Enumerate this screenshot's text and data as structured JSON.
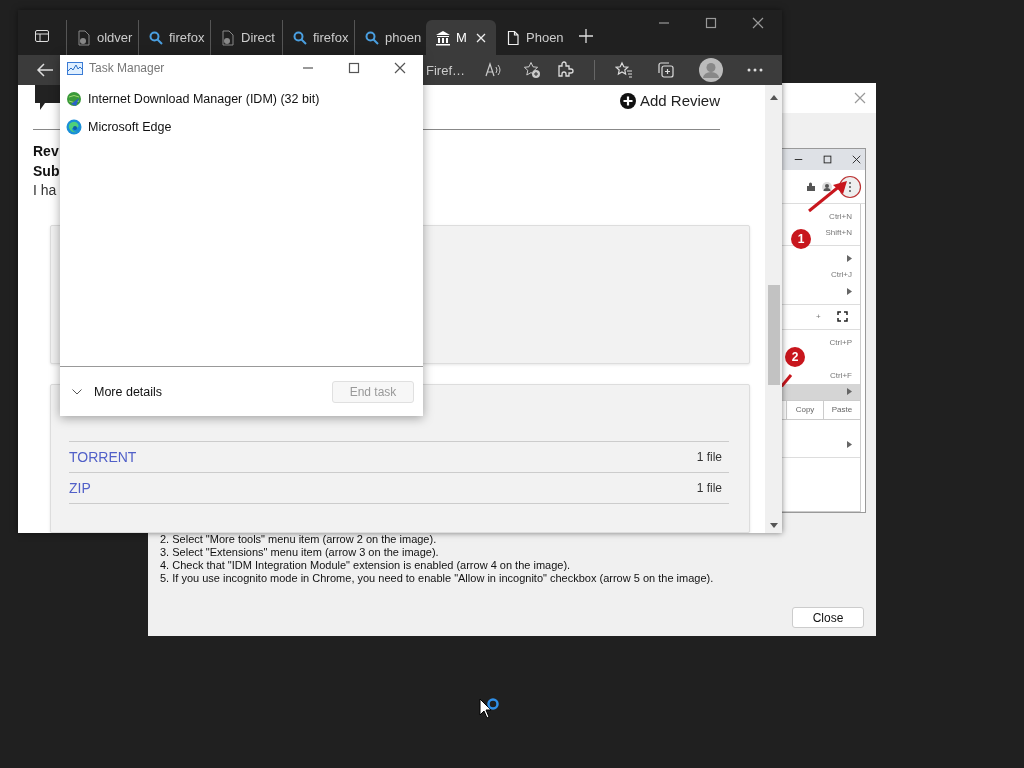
{
  "idm_dialog": {
    "screenshot": {
      "shortcuts": [
        {
          "kind": "text",
          "text": "Ctrl+N"
        },
        {
          "kind": "text",
          "text": "Shift+N"
        },
        {
          "kind": "sep"
        },
        {
          "kind": "sub"
        },
        {
          "kind": "text",
          "text": "Ctrl+J"
        },
        {
          "kind": "sub"
        },
        {
          "kind": "sep"
        },
        {
          "kind": "zoom",
          "text": "+"
        },
        {
          "kind": "sep"
        },
        {
          "kind": "text",
          "text": "Ctrl+P"
        },
        {
          "kind": "blank"
        },
        {
          "kind": "text",
          "text": "Ctrl+F"
        },
        {
          "kind": "hilite"
        },
        {
          "kind": "edit",
          "texts": [
            "Copy",
            "Paste"
          ]
        },
        {
          "kind": "blank"
        },
        {
          "kind": "sub"
        },
        {
          "kind": "sep"
        }
      ],
      "callouts": [
        "1",
        "2"
      ]
    },
    "instructions": [
      "2. Select \"More tools\" menu item (arrow 2 on the image).",
      "3. Select \"Extensions\" menu item (arrow 3 on the image).",
      "4. Check that \"IDM Integration Module\" extension is enabled (arrow 4 on the image).",
      "5. If you use incognito mode in Chrome, you need to enable \"Allow in incognito\" checkbox (arrow 5 on the image)."
    ],
    "close_button": "Close"
  },
  "browser": {
    "tabs": [
      {
        "label": "oldver",
        "kind": "page",
        "selected": false
      },
      {
        "label": "firefox",
        "kind": "search",
        "selected": false
      },
      {
        "label": "Direct",
        "kind": "page",
        "selected": false
      },
      {
        "label": "firefox",
        "kind": "search",
        "selected": false
      },
      {
        "label": "phoen",
        "kind": "search",
        "selected": false
      },
      {
        "label": "M",
        "kind": "museum",
        "selected": true
      },
      {
        "label": "Phoen",
        "kind": "document",
        "selected": false
      }
    ],
    "address_text": "Firef…",
    "page": {
      "add_review": "Add Review",
      "review_lines": [
        {
          "text": "Rev",
          "bold": true
        },
        {
          "text": "Sub",
          "bold": true
        },
        {
          "text": "I ha",
          "bold": false
        }
      ],
      "download_rows": [
        {
          "name": "TORRENT",
          "count": "1 file"
        },
        {
          "name": "ZIP",
          "count": "1 file"
        }
      ]
    }
  },
  "task_manager": {
    "title": "Task Manager",
    "apps": [
      {
        "name": "Internet Download Manager (IDM) (32 bit)",
        "kind": "idm"
      },
      {
        "name": "Microsoft Edge",
        "kind": "edge"
      }
    ],
    "more_details": "More details",
    "end_task": {
      "label": "End task",
      "disabled": true
    }
  }
}
